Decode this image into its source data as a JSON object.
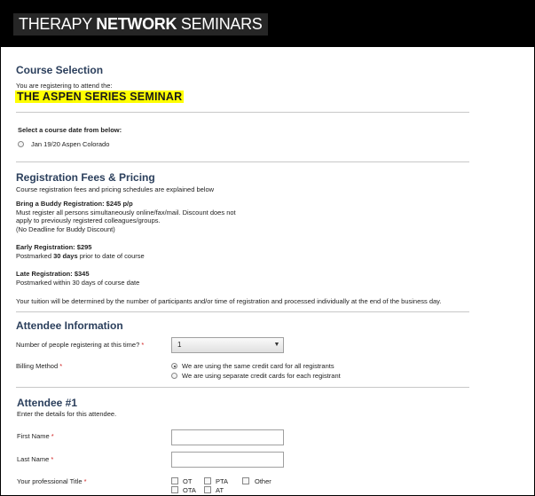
{
  "header": {
    "logo_light": "THERAPY ",
    "logo_bold": "NETWORK",
    "logo_light2": " SEMINARS"
  },
  "course_selection": {
    "heading": "Course Selection",
    "registering_text": "You are registering to attend the:",
    "seminar_name": "THE ASPEN SERIES SEMINAR",
    "select_date_label": "Select a course date from below:",
    "date_option": "Jan 19/20 Aspen Colorado"
  },
  "fees": {
    "heading": "Registration Fees & Pricing",
    "intro": "Course registration fees and pricing schedules are explained below",
    "buddy_title": "Bring a Buddy Registration: $245 p/p",
    "buddy_line1": "Must register all persons simultaneously online/fax/mail.   Discount does not",
    "buddy_line2": "apply to previously registered colleagues/groups.",
    "buddy_line3": "(No Deadline for Buddy Discount)",
    "early_title": "Early Registration: $295",
    "early_prefix": "Postmarked ",
    "early_bold": "30 days",
    "early_suffix": " prior to date of course",
    "late_title": "Late Registration: $345",
    "late_line": "Postmarked within 30 days of course date",
    "tuition_note": "Your tuition will be determined by the number of participants and/or time of registration and processed individually at the end of the business day."
  },
  "attendee_info": {
    "heading": "Attendee Information",
    "num_people_label": "Number of people registering at this time?",
    "num_people_value": "1",
    "billing_label": "Billing Method",
    "billing_option1": "We are using the same credit card for all registrants",
    "billing_option2": "We are using separate credit cards for each registrant",
    "required_mark": "*"
  },
  "attendee1": {
    "heading": "Attendee #1",
    "subtext": "Enter the details for this attendee.",
    "first_name_label": "First Name",
    "last_name_label": "Last Name",
    "title_label": "Your professional Title",
    "titles": [
      "OT",
      "PTA",
      "Other",
      "OTA",
      "AT"
    ]
  }
}
